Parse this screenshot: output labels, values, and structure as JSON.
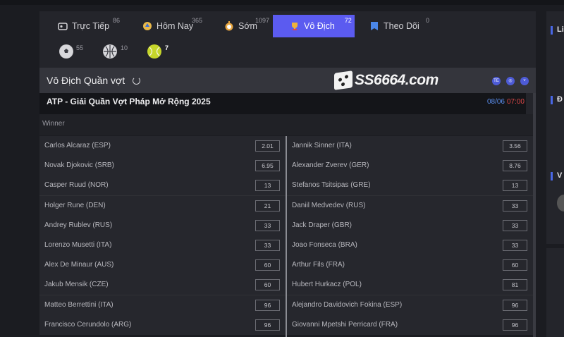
{
  "tabs": [
    {
      "label": "Trực Tiếp",
      "count": "86",
      "icon": "live-icon"
    },
    {
      "label": "Hôm Nay",
      "count": "365",
      "icon": "today-icon"
    },
    {
      "label": "Sớm",
      "count": "1097",
      "icon": "early-icon"
    },
    {
      "label": "Vô Địch",
      "count": "72",
      "icon": "trophy-icon",
      "active": true
    },
    {
      "label": "Theo Dõi",
      "count": "0",
      "icon": "follow-icon"
    }
  ],
  "sports": [
    {
      "name": "soccer-ball-icon",
      "count": "55"
    },
    {
      "name": "basketball-icon",
      "count": "10"
    },
    {
      "name": "tennis-ball-icon",
      "count": "7"
    }
  ],
  "section": {
    "title": "Vô Địch Quần vợt",
    "logo_s": "S",
    "logo_text": "S6664.com"
  },
  "match": {
    "name": "ATP - Giải Quần Vợt Pháp Mở Rộng 2025",
    "date": "08/06",
    "time": "07:00"
  },
  "market": {
    "label": "Winner"
  },
  "odds": [
    [
      {
        "name": "Carlos Alcaraz (ESP)",
        "odd": "2.01"
      },
      {
        "name": "Jannik Sinner (ITA)",
        "odd": "3.56"
      }
    ],
    [
      {
        "name": "Novak Djokovic (SRB)",
        "odd": "6.95"
      },
      {
        "name": "Alexander Zverev (GER)",
        "odd": "8.76"
      }
    ],
    [
      {
        "name": "Casper Ruud (NOR)",
        "odd": "13"
      },
      {
        "name": "Stefanos Tsitsipas (GRE)",
        "odd": "13"
      }
    ],
    [
      {
        "name": "Holger Rune (DEN)",
        "odd": "21"
      },
      {
        "name": "Daniil Medvedev (RUS)",
        "odd": "33"
      }
    ],
    [
      {
        "name": "Andrey Rublev (RUS)",
        "odd": "33"
      },
      {
        "name": "Jack Draper (GBR)",
        "odd": "33"
      }
    ],
    [
      {
        "name": "Lorenzo Musetti (ITA)",
        "odd": "33"
      },
      {
        "name": "Joao Fonseca (BRA)",
        "odd": "33"
      }
    ],
    [
      {
        "name": "Alex De Minaur (AUS)",
        "odd": "60"
      },
      {
        "name": "Arthur Fils (FRA)",
        "odd": "60"
      }
    ],
    [
      {
        "name": "Jakub Mensik (CZE)",
        "odd": "60"
      },
      {
        "name": "Hubert Hurkacz (POL)",
        "odd": "81"
      }
    ],
    [
      {
        "name": "Matteo Berrettini (ITA)",
        "odd": "96"
      },
      {
        "name": "Alejandro Davidovich Fokina (ESP)",
        "odd": "96"
      }
    ],
    [
      {
        "name": "Francisco Cerundolo (ARG)",
        "odd": "96"
      },
      {
        "name": "Giovanni Mpetshi Perricard (FRA)",
        "odd": "96"
      }
    ]
  ],
  "right": {
    "letters": [
      "Li",
      "Đ",
      "V"
    ]
  },
  "colors": {
    "accent": "#5b5bf0",
    "date": "#5b8ff0",
    "time": "#e04848"
  }
}
